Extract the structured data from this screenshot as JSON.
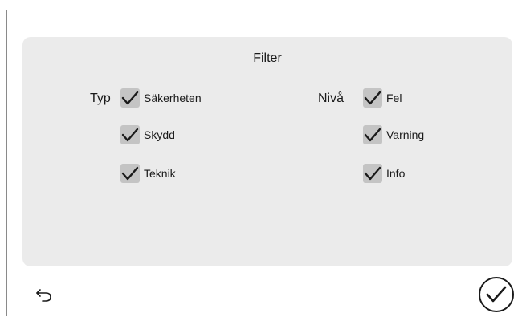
{
  "panel": {
    "title": "Filter"
  },
  "typ": {
    "label": "Typ",
    "options": [
      {
        "label": "Säkerheten",
        "checked": true
      },
      {
        "label": "Skydd",
        "checked": true
      },
      {
        "label": "Teknik",
        "checked": true
      }
    ]
  },
  "niva": {
    "label": "Nivå",
    "options": [
      {
        "label": "Fel",
        "checked": true
      },
      {
        "label": "Varning",
        "checked": true
      },
      {
        "label": "Info",
        "checked": true
      }
    ]
  },
  "icons": {
    "back": "back-arrow-icon",
    "confirm": "circle-check-icon",
    "check": "checkmark-icon"
  },
  "colors": {
    "panel_bg": "#ebebeb",
    "checkbox_bg": "#c4c4c4",
    "check_stroke": "#1a1a1a"
  }
}
